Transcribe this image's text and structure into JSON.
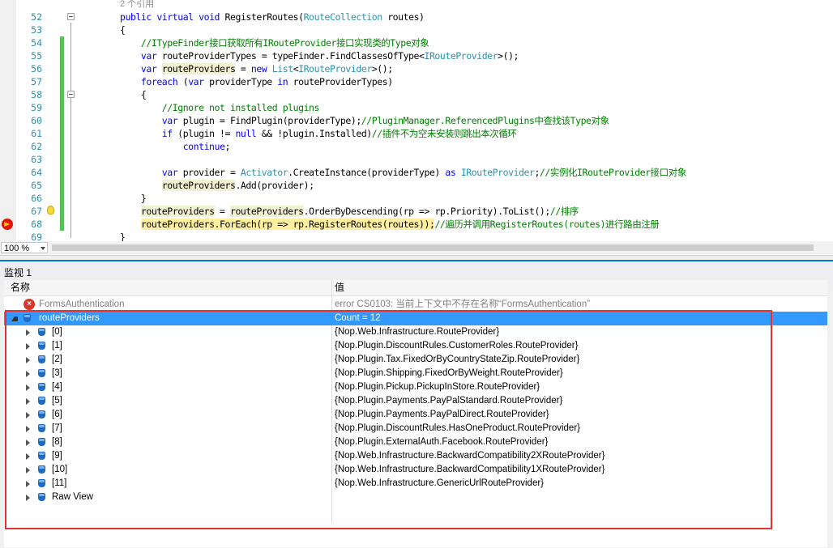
{
  "editor": {
    "zoom": "100 %",
    "lines": [
      {
        "num": "",
        "code": [
          {
            "t": "2 个引用",
            "c": "refs"
          }
        ]
      },
      {
        "num": "52",
        "code": [
          {
            "t": "public",
            "c": "kw"
          },
          {
            "t": " "
          },
          {
            "t": "virtual",
            "c": "kw"
          },
          {
            "t": " "
          },
          {
            "t": "void",
            "c": "kw"
          },
          {
            "t": " RegisterRoutes("
          },
          {
            "t": "RouteCollection",
            "c": "ty"
          },
          {
            "t": " routes)"
          }
        ]
      },
      {
        "num": "53",
        "code": [
          {
            "t": "{"
          }
        ]
      },
      {
        "num": "54",
        "code": [
          {
            "t": "    "
          },
          {
            "t": "//ITypeFinder接口获取所有IRouteProvider接口实现类的Type对象",
            "c": "cm"
          }
        ]
      },
      {
        "num": "55",
        "code": [
          {
            "t": "    "
          },
          {
            "t": "var",
            "c": "kw"
          },
          {
            "t": " routeProviderTypes = typeFinder.FindClassesOfType<"
          },
          {
            "t": "IRouteProvider",
            "c": "ty"
          },
          {
            "t": ">();"
          }
        ]
      },
      {
        "num": "56",
        "code": [
          {
            "t": "    "
          },
          {
            "t": "var",
            "c": "kw"
          },
          {
            "t": " "
          },
          {
            "t": "routeProviders",
            "c": "hl"
          },
          {
            "t": " = "
          },
          {
            "t": "new",
            "c": "kw"
          },
          {
            "t": " "
          },
          {
            "t": "List",
            "c": "ty"
          },
          {
            "t": "<"
          },
          {
            "t": "IRouteProvider",
            "c": "ty"
          },
          {
            "t": ">();"
          }
        ]
      },
      {
        "num": "57",
        "code": [
          {
            "t": "    "
          },
          {
            "t": "foreach",
            "c": "kw"
          },
          {
            "t": " ("
          },
          {
            "t": "var",
            "c": "kw"
          },
          {
            "t": " providerType "
          },
          {
            "t": "in",
            "c": "kw"
          },
          {
            "t": " routeProviderTypes)"
          }
        ]
      },
      {
        "num": "58",
        "code": [
          {
            "t": "    {"
          }
        ]
      },
      {
        "num": "59",
        "code": [
          {
            "t": "        "
          },
          {
            "t": "//Ignore not installed plugins",
            "c": "cm"
          }
        ]
      },
      {
        "num": "60",
        "code": [
          {
            "t": "        "
          },
          {
            "t": "var",
            "c": "kw"
          },
          {
            "t": " plugin = FindPlugin(providerType);"
          },
          {
            "t": "//PluginManager.ReferencedPlugins中查找该Type对象",
            "c": "cm"
          }
        ]
      },
      {
        "num": "61",
        "code": [
          {
            "t": "        "
          },
          {
            "t": "if",
            "c": "kw"
          },
          {
            "t": " (plugin != "
          },
          {
            "t": "null",
            "c": "kw"
          },
          {
            "t": " && !plugin.Installed)"
          },
          {
            "t": "//插件不为空未安装则跳出本次循环",
            "c": "cm"
          }
        ]
      },
      {
        "num": "62",
        "code": [
          {
            "t": "            "
          },
          {
            "t": "continue",
            "c": "kw"
          },
          {
            "t": ";"
          }
        ]
      },
      {
        "num": "63",
        "code": []
      },
      {
        "num": "64",
        "code": [
          {
            "t": "        "
          },
          {
            "t": "var",
            "c": "kw"
          },
          {
            "t": " provider = "
          },
          {
            "t": "Activator",
            "c": "ty"
          },
          {
            "t": ".CreateInstance(providerType) "
          },
          {
            "t": "as",
            "c": "kw"
          },
          {
            "t": " "
          },
          {
            "t": "IRouteProvider",
            "c": "ty"
          },
          {
            "t": ";"
          },
          {
            "t": "//实例化IRouteProvider接口对象",
            "c": "cm"
          }
        ]
      },
      {
        "num": "65",
        "code": [
          {
            "t": "        "
          },
          {
            "t": "routeProviders",
            "c": "hl"
          },
          {
            "t": ".Add(provider);"
          }
        ]
      },
      {
        "num": "66",
        "code": [
          {
            "t": "    }"
          }
        ]
      },
      {
        "num": "67",
        "code": [
          {
            "t": "    "
          },
          {
            "t": "routeProviders",
            "c": "hl"
          },
          {
            "t": " = "
          },
          {
            "t": "routeProviders",
            "c": "hl"
          },
          {
            "t": ".OrderByDescending(rp => rp.Priority).ToList();"
          },
          {
            "t": "//排序",
            "c": "cm"
          }
        ]
      },
      {
        "num": "68",
        "code": [
          {
            "t": "    "
          },
          {
            "t": "routeProviders.ForEach(rp => rp.RegisterRoutes(routes));",
            "c": "yhl"
          },
          {
            "t": "//遍历并调用RegisterRoutes(routes)进行路由注册",
            "c": "cm"
          }
        ]
      },
      {
        "num": "69",
        "code": [
          {
            "t": "}"
          }
        ]
      }
    ]
  },
  "watch": {
    "title": "监视 1",
    "col_name": "名称",
    "col_value": "值",
    "error_row": {
      "name": "FormsAuthentication",
      "value": "error CS0103: 当前上下文中不存在名称“FormsAuthentication”"
    },
    "root": {
      "name": "routeProviders",
      "value": "Count = 12"
    },
    "items": [
      {
        "name": "[0]",
        "value": "{Nop.Web.Infrastructure.RouteProvider}"
      },
      {
        "name": "[1]",
        "value": "{Nop.Plugin.DiscountRules.CustomerRoles.RouteProvider}"
      },
      {
        "name": "[2]",
        "value": "{Nop.Plugin.Tax.FixedOrByCountryStateZip.RouteProvider}"
      },
      {
        "name": "[3]",
        "value": "{Nop.Plugin.Shipping.FixedOrByWeight.RouteProvider}"
      },
      {
        "name": "[4]",
        "value": "{Nop.Plugin.Pickup.PickupInStore.RouteProvider}"
      },
      {
        "name": "[5]",
        "value": "{Nop.Plugin.Payments.PayPalStandard.RouteProvider}"
      },
      {
        "name": "[6]",
        "value": "{Nop.Plugin.Payments.PayPalDirect.RouteProvider}"
      },
      {
        "name": "[7]",
        "value": "{Nop.Plugin.DiscountRules.HasOneProduct.RouteProvider}"
      },
      {
        "name": "[8]",
        "value": "{Nop.Plugin.ExternalAuth.Facebook.RouteProvider}"
      },
      {
        "name": "[9]",
        "value": "{Nop.Web.Infrastructure.BackwardCompatibility2XRouteProvider}"
      },
      {
        "name": "[10]",
        "value": "{Nop.Web.Infrastructure.BackwardCompatibility1XRouteProvider}"
      },
      {
        "name": "[11]",
        "value": "{Nop.Web.Infrastructure.GenericUrlRouteProvider}"
      }
    ],
    "raw_view": "Raw View"
  }
}
